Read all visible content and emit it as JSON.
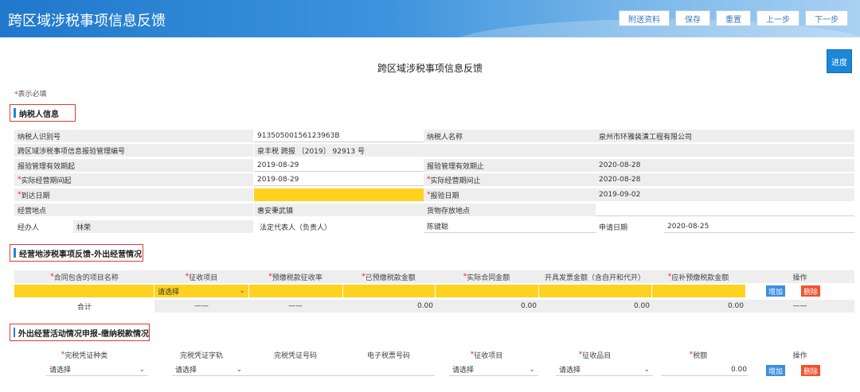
{
  "header": {
    "title": "跨区域涉税事项信息反馈",
    "buttons": [
      "附送资料",
      "保存",
      "重置",
      "上一步",
      "下一步"
    ]
  },
  "page_title": "跨区域涉税事项信息反馈",
  "progress_button": "进度",
  "required_note": {
    "star": "*",
    "text": "表示必填"
  },
  "section1": {
    "title": "纳税人信息",
    "rows": [
      {
        "label1": "纳税人识别号",
        "value1": "91350500156123963B",
        "label2": "纳税人名称",
        "value2": "泉州市环雅装潢工程有限公司"
      },
      {
        "label1": "跨区域涉税事项信息报验管理编号",
        "value1": "泉丰税 跨报 〔2019〕 92913 号",
        "label2": "",
        "value2": ""
      },
      {
        "label1": "报验管理有效期起",
        "value1": "2019-08-29",
        "label2": "报验管理有效期止",
        "value2": "2020-08-28"
      },
      {
        "label1": "实际经营期间起",
        "value1": "2019-08-29",
        "label2": "实际经营期间止",
        "value2": "2020-08-28"
      },
      {
        "label1": "到达日期",
        "value1": "",
        "label2": "报验日期",
        "value2": "2019-09-02"
      },
      {
        "label1": "经营地点",
        "value1": "惠安秉武镇",
        "label2": "货物存放地点",
        "value2": ""
      }
    ],
    "last_row": {
      "agent_label": "经办人",
      "agent_value": "林荣",
      "legal_label": "法定代表人（负责人）",
      "legal_value": "陈键聪",
      "date_label": "申请日期",
      "date_value": "2020-08-25"
    }
  },
  "section2": {
    "title": "经营地涉税事项反馈-外出经营情况",
    "columns": [
      "合同包含的项目名称",
      "征收项目",
      "预缴税款征收率",
      "已预缴税款金额",
      "实际合同金额",
      "开具发票金额（含自开和代开）",
      "应补预缴税款金额",
      "操作"
    ],
    "select_placeholder": "请选择",
    "add_label": "增加",
    "delete_label": "删除",
    "total_label": "合计",
    "totals": [
      "——",
      "——",
      "0.00",
      "0.00",
      "0.00",
      "0.00",
      "——"
    ]
  },
  "section3": {
    "title": "外出经营活动情况申报-缴纳税款情况",
    "columns": [
      "完税凭证种类",
      "完税凭证字轨",
      "完税凭证号码",
      "电子税票号码",
      "征收项目",
      "征收品目",
      "税额",
      "操作"
    ],
    "select_placeholder": "请选择",
    "tax_value": "0.00",
    "add_label": "增加",
    "delete_label": "删除"
  },
  "colors": {
    "accent": "#1a87d8",
    "required_fill": "#ffd21f",
    "delete": "#f0522d",
    "add": "#3b8fe0"
  }
}
